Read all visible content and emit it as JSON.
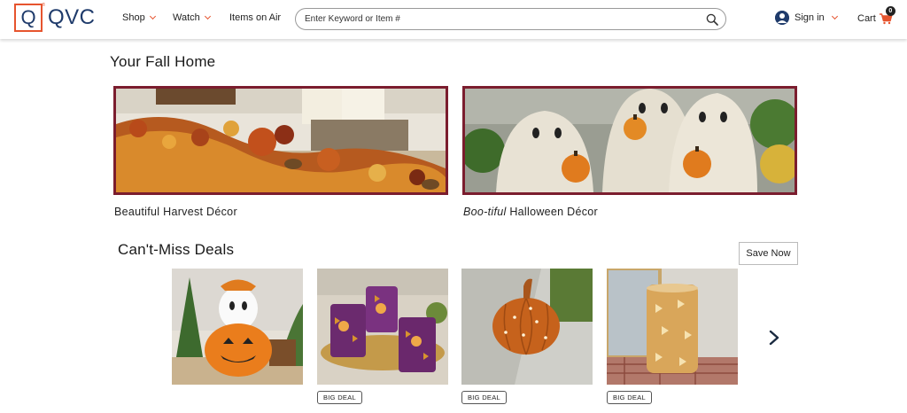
{
  "header": {
    "logo_letter": "Q",
    "logo_text": "QVC",
    "nav": [
      {
        "label": "Shop"
      },
      {
        "label": "Watch"
      },
      {
        "label": "Items on Air"
      }
    ],
    "search_placeholder": "Enter Keyword or Item #",
    "sign_in_label": "Sign in",
    "cart_label": "Cart",
    "cart_count": "0"
  },
  "fall_home": {
    "title": "Your Fall Home",
    "tiles": [
      {
        "caption": "Beautiful Harvest Décor"
      },
      {
        "caption_italic": "Boo-tiful",
        "caption_rest": " Halloween Décor"
      }
    ]
  },
  "deals": {
    "title": "Can't-Miss Deals",
    "save_now_label": "Save Now",
    "items": [
      {
        "badge": ""
      },
      {
        "badge": "BIG DEAL"
      },
      {
        "badge": "BIG DEAL"
      },
      {
        "badge": "BIG DEAL"
      }
    ]
  },
  "colors": {
    "brand_orange": "#e6542e",
    "brand_navy": "#1f3b6b",
    "tile_border": "#7b1d2e",
    "heading_highlight": "#f6d8cb"
  }
}
